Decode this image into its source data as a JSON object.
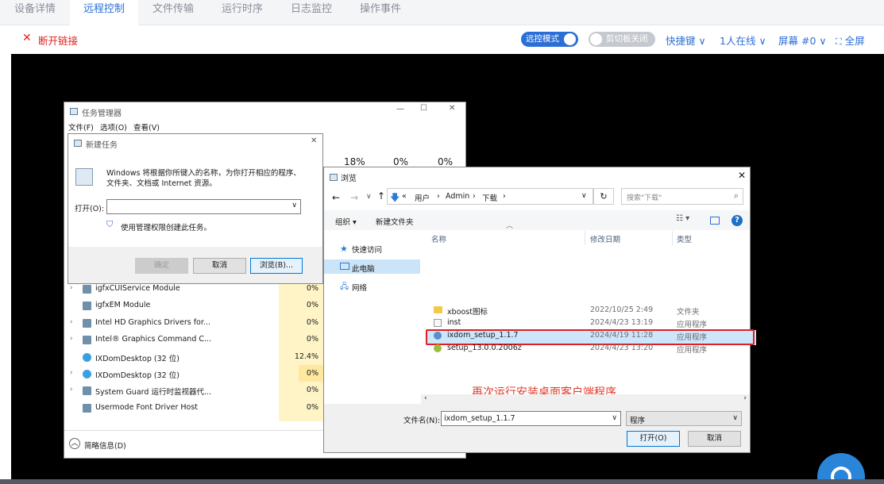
{
  "tabs": [
    "设备详情",
    "远程控制",
    "文件传输",
    "运行时序",
    "日志监控",
    "操作事件"
  ],
  "toolbar": {
    "disconnect": "断开链接",
    "remote_mode": "远控模式",
    "clipboard": "剪切板关闭",
    "shortcut": "快捷键",
    "online": "1人在线",
    "screen": "屏幕 #0",
    "fullscreen": "全屏"
  },
  "task_manager": {
    "title": "任务管理器",
    "menu": [
      "文件(F)",
      "选项(O)",
      "查看(V)"
    ],
    "cols": [
      "18%",
      "0%",
      "0%"
    ],
    "rows": [
      {
        "name": "igfxCUIService Module",
        "val": "0%",
        "expand": true
      },
      {
        "name": "igfxEM Module",
        "val": "0%",
        "expand": false
      },
      {
        "name": "Intel HD Graphics Drivers for...",
        "val": "0%",
        "expand": true
      },
      {
        "name": "Intel® Graphics Command C...",
        "val": "0%",
        "expand": true
      },
      {
        "name": "IXDomDesktop (32 位)",
        "val": "12.4%",
        "expand": false
      },
      {
        "name": "IXDomDesktop (32 位)",
        "val": "0%",
        "expand": true
      },
      {
        "name": "System Guard 运行时监视器代...",
        "val": "0%",
        "expand": true
      },
      {
        "name": "Usermode Font Driver Host",
        "val": "0%",
        "expand": false
      }
    ],
    "summary": "简略信息(D)"
  },
  "new_task": {
    "title": "新建任务",
    "desc1": "Windows 将根据你所键入的名称，为你打开相应的程序、",
    "desc2": "文件夹、文档或 Internet 资源。",
    "open_label": "打开(O):",
    "admin_text": "使用管理权限创建此任务。",
    "ok": "确定",
    "cancel": "取消",
    "browse": "浏览(B)..."
  },
  "browse": {
    "title": "浏览",
    "crumbs": [
      "用户",
      "Admin",
      "下载"
    ],
    "search_placeholder": "搜索\"下载\"",
    "organize": "组织 ▾",
    "new_folder": "新建文件夹",
    "nav": [
      "快速访问",
      "此电脑",
      "网络"
    ],
    "headers": [
      "名称",
      "修改日期",
      "类型"
    ],
    "files": [
      {
        "name": "xboost图标",
        "date": "2022/10/25 2:49",
        "type": "文件夹"
      },
      {
        "name": "inst",
        "date": "2024/4/23 13:19",
        "type": "应用程序"
      },
      {
        "name": "ixdom_setup_1.1.7",
        "date": "2024/4/19 11:28",
        "type": "应用程序"
      },
      {
        "name": "setup_13.0.0.2006z",
        "date": "2024/4/23 13:20",
        "type": "应用程序"
      }
    ],
    "annotation": "再次运行安装桌面客户端程序",
    "filename_label": "文件名(N):",
    "filename_value": "ixdom_setup_1.1.7",
    "filetype": "程序",
    "open_btn": "打开(O)",
    "cancel_btn": "取消"
  },
  "colors": {
    "accent": "#2b6fd6",
    "highlight_border": "#e02020",
    "annotation": "#e03a2a"
  }
}
